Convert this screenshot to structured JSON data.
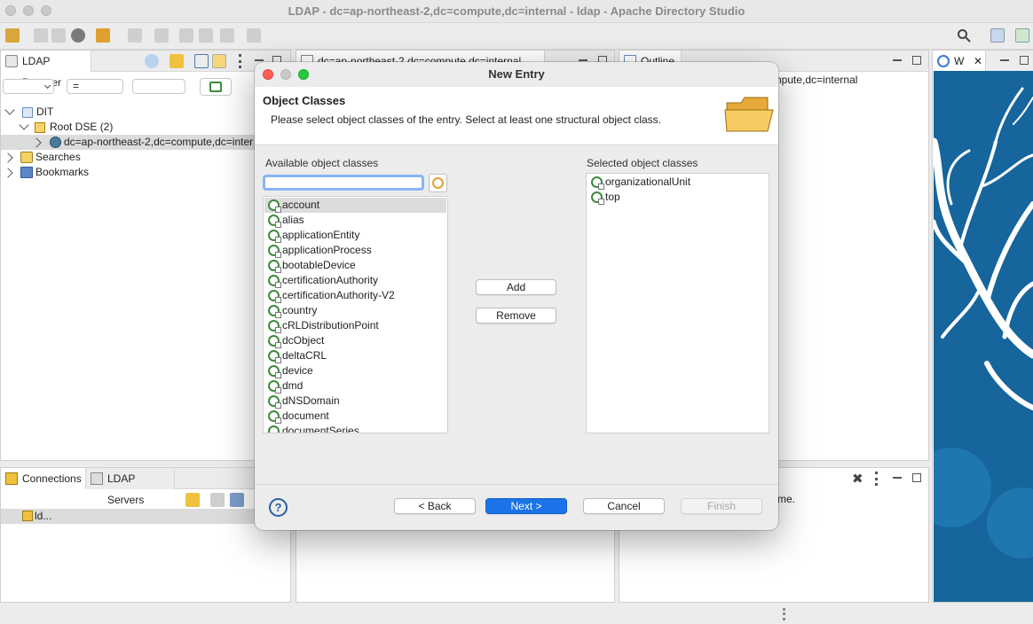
{
  "window": {
    "title": "LDAP - dc=ap-northeast-2,dc=compute,dc=internal - ldap - Apache Directory Studio"
  },
  "ldap_browser": {
    "tab_label": "LDAP Browser",
    "filter_operator": "=",
    "tree": {
      "dit": "DIT",
      "root_dse": "Root DSE (2)",
      "entry": "dc=ap-northeast-2,dc=compute,dc=inter",
      "searches": "Searches",
      "bookmarks": "Bookmarks"
    }
  },
  "editor_tab": {
    "label": "dc=ap-northeast-2,dc=compute,dc=internal"
  },
  "outline": {
    "tab_label": "Outline",
    "content_fragment": "npute,dc=internal"
  },
  "welcome": {
    "tab_label": "W"
  },
  "connections": {
    "tabs": [
      "Connections",
      "LDAP Servers"
    ],
    "item": "ld..."
  },
  "bottom_right": {
    "text_fragment": "me."
  },
  "dialog": {
    "title": "New Entry",
    "header_title": "Object Classes",
    "header_description": "Please select object classes of the entry. Select at least one structural object class.",
    "available_label": "Available object classes",
    "filter_value": "",
    "available": [
      "account",
      "alias",
      "applicationEntity",
      "applicationProcess",
      "bootableDevice",
      "certificationAuthority",
      "certificationAuthority-V2",
      "country",
      "cRLDistributionPoint",
      "dcObject",
      "deltaCRL",
      "device",
      "dmd",
      "dNSDomain",
      "document",
      "documentSeries"
    ],
    "selected_available": "account",
    "selected_label": "Selected object classes",
    "selected": [
      "organizationalUnit",
      "top"
    ],
    "add": "Add",
    "remove": "Remove",
    "help": "?",
    "back": "< Back",
    "next": "Next >",
    "cancel": "Cancel",
    "finish": "Finish"
  },
  "colors": {
    "primary_button": "#1a73e8",
    "focus_ring": "#8ab4f8",
    "objectclass_icon": "#3d8a3d",
    "art_background": "#16659c"
  }
}
